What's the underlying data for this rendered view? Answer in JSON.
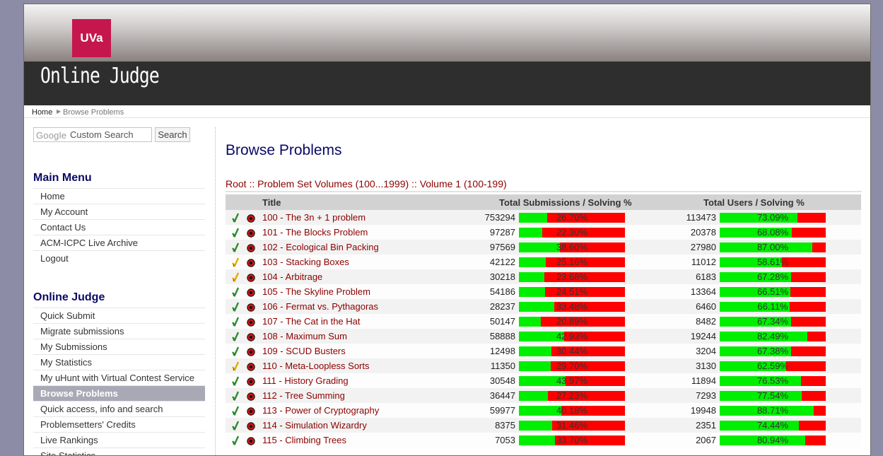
{
  "header": {
    "logo_text": "UVa",
    "site_title": "Online Judge"
  },
  "breadcrumb": {
    "home": "Home",
    "current": "Browse Problems"
  },
  "search": {
    "google_label": "Google",
    "placeholder": "Custom Search",
    "button": "Search"
  },
  "main_menu": {
    "heading": "Main Menu",
    "items": [
      "Home",
      "My Account",
      "Contact Us",
      "ACM-ICPC Live Archive",
      "Logout"
    ]
  },
  "judge_menu": {
    "heading": "Online Judge",
    "items": [
      "Quick Submit",
      "Migrate submissions",
      "My Submissions",
      "My Statistics",
      "My uHunt with Virtual Contest Service",
      "Browse Problems",
      "Quick access, info and search",
      "Problemsetters' Credits",
      "Live Rankings",
      "Site Statistics"
    ],
    "active": "Browse Problems"
  },
  "page": {
    "title": "Browse Problems",
    "crumbs": "Root :: Problem Set Volumes (100...1999) :: Volume 1 (100-199)"
  },
  "table": {
    "headers": {
      "title": "Title",
      "submissions": "Total Submissions / Solving %",
      "users": "Total Users / Solving %"
    },
    "rows": [
      {
        "status": "solved",
        "title": "100 - The 3n + 1 problem",
        "subs": "753294",
        "sub_pct": "26.70%",
        "sub_val": 26.7,
        "users": "113473",
        "user_pct": "73.09%",
        "user_val": 73.09
      },
      {
        "status": "solved",
        "title": "101 - The Blocks Problem",
        "subs": "97287",
        "sub_pct": "22.30%",
        "sub_val": 22.3,
        "users": "20378",
        "user_pct": "68.08%",
        "user_val": 68.08
      },
      {
        "status": "solved",
        "title": "102 - Ecological Bin Packing",
        "subs": "97569",
        "sub_pct": "38.60%",
        "sub_val": 38.6,
        "users": "27980",
        "user_pct": "87.00%",
        "user_val": 87.0
      },
      {
        "status": "tried",
        "title": "103 - Stacking Boxes",
        "subs": "42122",
        "sub_pct": "25.16%",
        "sub_val": 25.16,
        "users": "11012",
        "user_pct": "58.61%",
        "user_val": 58.61
      },
      {
        "status": "tried",
        "title": "104 - Arbitrage",
        "subs": "30218",
        "sub_pct": "23.68%",
        "sub_val": 23.68,
        "users": "6183",
        "user_pct": "67.28%",
        "user_val": 67.28
      },
      {
        "status": "solved",
        "title": "105 - The Skyline Problem",
        "subs": "54186",
        "sub_pct": "24.51%",
        "sub_val": 24.51,
        "users": "13364",
        "user_pct": "66.51%",
        "user_val": 66.51
      },
      {
        "status": "solved",
        "title": "106 - Fermat vs. Pythagoras",
        "subs": "28237",
        "sub_pct": "33.48%",
        "sub_val": 33.48,
        "users": "6460",
        "user_pct": "66.11%",
        "user_val": 66.11
      },
      {
        "status": "solved",
        "title": "107 - The Cat in the Hat",
        "subs": "50147",
        "sub_pct": "20.89%",
        "sub_val": 20.89,
        "users": "8482",
        "user_pct": "67.34%",
        "user_val": 67.34
      },
      {
        "status": "solved",
        "title": "108 - Maximum Sum",
        "subs": "58888",
        "sub_pct": "42.93%",
        "sub_val": 42.93,
        "users": "19244",
        "user_pct": "82.49%",
        "user_val": 82.49
      },
      {
        "status": "solved",
        "title": "109 - SCUD Busters",
        "subs": "12498",
        "sub_pct": "30.44%",
        "sub_val": 30.44,
        "users": "3204",
        "user_pct": "67.38%",
        "user_val": 67.38
      },
      {
        "status": "tried",
        "title": "110 - Meta-Loopless Sorts",
        "subs": "11350",
        "sub_pct": "29.70%",
        "sub_val": 29.7,
        "users": "3130",
        "user_pct": "62.59%",
        "user_val": 62.59
      },
      {
        "status": "solved",
        "title": "111 - History Grading",
        "subs": "30548",
        "sub_pct": "43.97%",
        "sub_val": 43.97,
        "users": "11894",
        "user_pct": "76.53%",
        "user_val": 76.53
      },
      {
        "status": "solved",
        "title": "112 - Tree Summing",
        "subs": "36447",
        "sub_pct": "27.23%",
        "sub_val": 27.23,
        "users": "7293",
        "user_pct": "77.54%",
        "user_val": 77.54
      },
      {
        "status": "solved",
        "title": "113 - Power of Cryptography",
        "subs": "59977",
        "sub_pct": "40.18%",
        "sub_val": 40.18,
        "users": "19948",
        "user_pct": "88.71%",
        "user_val": 88.71
      },
      {
        "status": "solved",
        "title": "114 - Simulation Wizardry",
        "subs": "8375",
        "sub_pct": "31.46%",
        "sub_val": 31.46,
        "users": "2351",
        "user_pct": "74.44%",
        "user_val": 74.44
      },
      {
        "status": "solved",
        "title": "115 - Climbing Trees",
        "subs": "7053",
        "sub_pct": "33.70%",
        "sub_val": 33.7,
        "users": "2067",
        "user_pct": "80.94%",
        "user_val": 80.94
      }
    ]
  },
  "colors": {
    "bar_good": "#00ee00",
    "bar_bad": "#ff0000",
    "link": "#8b0000",
    "heading": "#0a0a66",
    "logo_bg": "#c5174e"
  }
}
